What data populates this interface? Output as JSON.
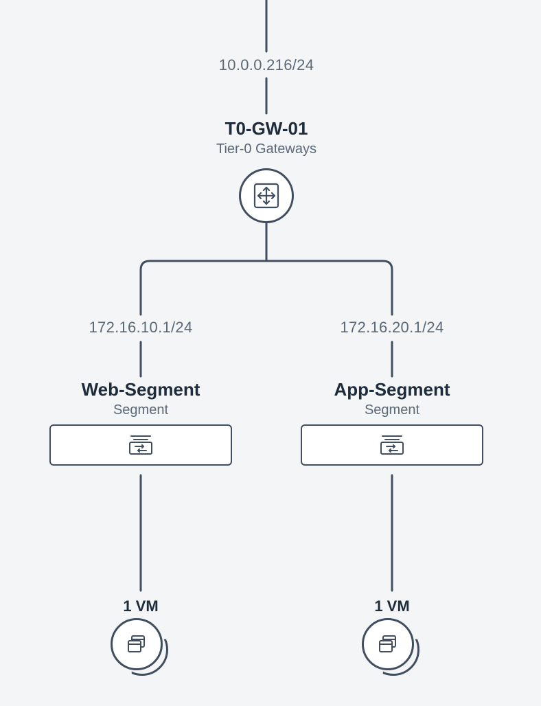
{
  "uplink": {
    "cidr": "10.0.0.216/24"
  },
  "gateway": {
    "name": "T0-GW-01",
    "type": "Tier-0 Gateways"
  },
  "segments": [
    {
      "cidr": "172.16.10.1/24",
      "name": "Web-Segment",
      "type": "Segment",
      "vm_count_label": "1 VM"
    },
    {
      "cidr": "172.16.20.1/24",
      "name": "App-Segment",
      "type": "Segment",
      "vm_count_label": "1 VM"
    }
  ]
}
